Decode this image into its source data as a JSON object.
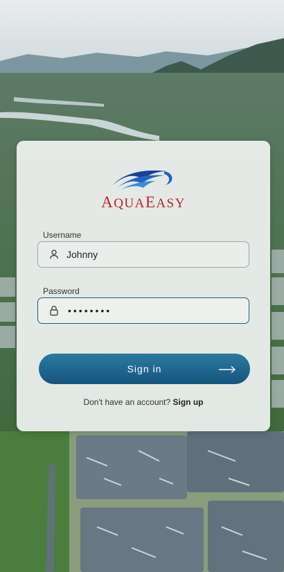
{
  "brand": {
    "name_first_big": "A",
    "name_first_rest": "QUA",
    "name_second_big": "E",
    "name_second_rest": "ASY",
    "color": "#b3232b",
    "logo_icon": "wave-logo-icon"
  },
  "username": {
    "label": "Username",
    "value": "Johnny",
    "icon": "user-icon"
  },
  "password": {
    "label": "Password",
    "masked_value": "••••••••",
    "icon": "lock-icon"
  },
  "signin": {
    "label": "Sign in",
    "icon": "arrow-right-icon"
  },
  "signup": {
    "prompt": "Don't have an account? ",
    "link": "Sign up"
  },
  "colors": {
    "primary": "#1a6690",
    "card": "#f4f6f5",
    "brand_red": "#b3232b"
  }
}
